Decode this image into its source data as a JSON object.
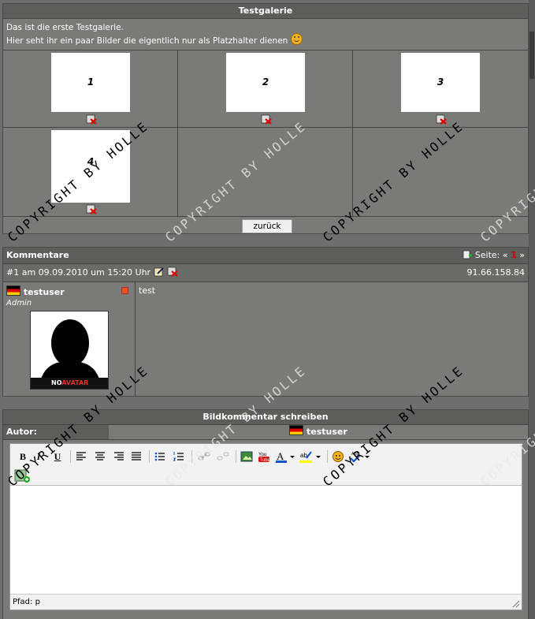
{
  "gallery": {
    "title": "Testgalerie",
    "intro_line1": "Das ist die erste Testgalerie.",
    "intro_line2": "Hier seht ihr ein paar Bilder die eigentlich nur als Platzhalter dienen",
    "images": [
      {
        "label": "1"
      },
      {
        "label": "2"
      },
      {
        "label": "3"
      },
      {
        "label": "4"
      }
    ],
    "back_button": "zurück"
  },
  "comments": {
    "title": "Kommentare",
    "page_label": "Seite:",
    "page_prev": "«",
    "page_current": "1",
    "page_next": "»",
    "entry": {
      "number": "#1",
      "date_text": "am 09.09.2010 um 15:20 Uhr",
      "ip": "91.66.158.84",
      "username": "testuser",
      "role": "Admin",
      "avatar_text_no": "NO",
      "avatar_text_avatar": "AVATAR",
      "message": "test"
    }
  },
  "write": {
    "title": "Bildkommentar schreiben",
    "author_label": "Autor:",
    "author_name": "testuser",
    "path_label": "Pfad: p"
  },
  "watermark": "COPYRIGHT BY HOLLE",
  "colors": {
    "accent_red": "#d00000",
    "bg": "#6e6e6e"
  }
}
